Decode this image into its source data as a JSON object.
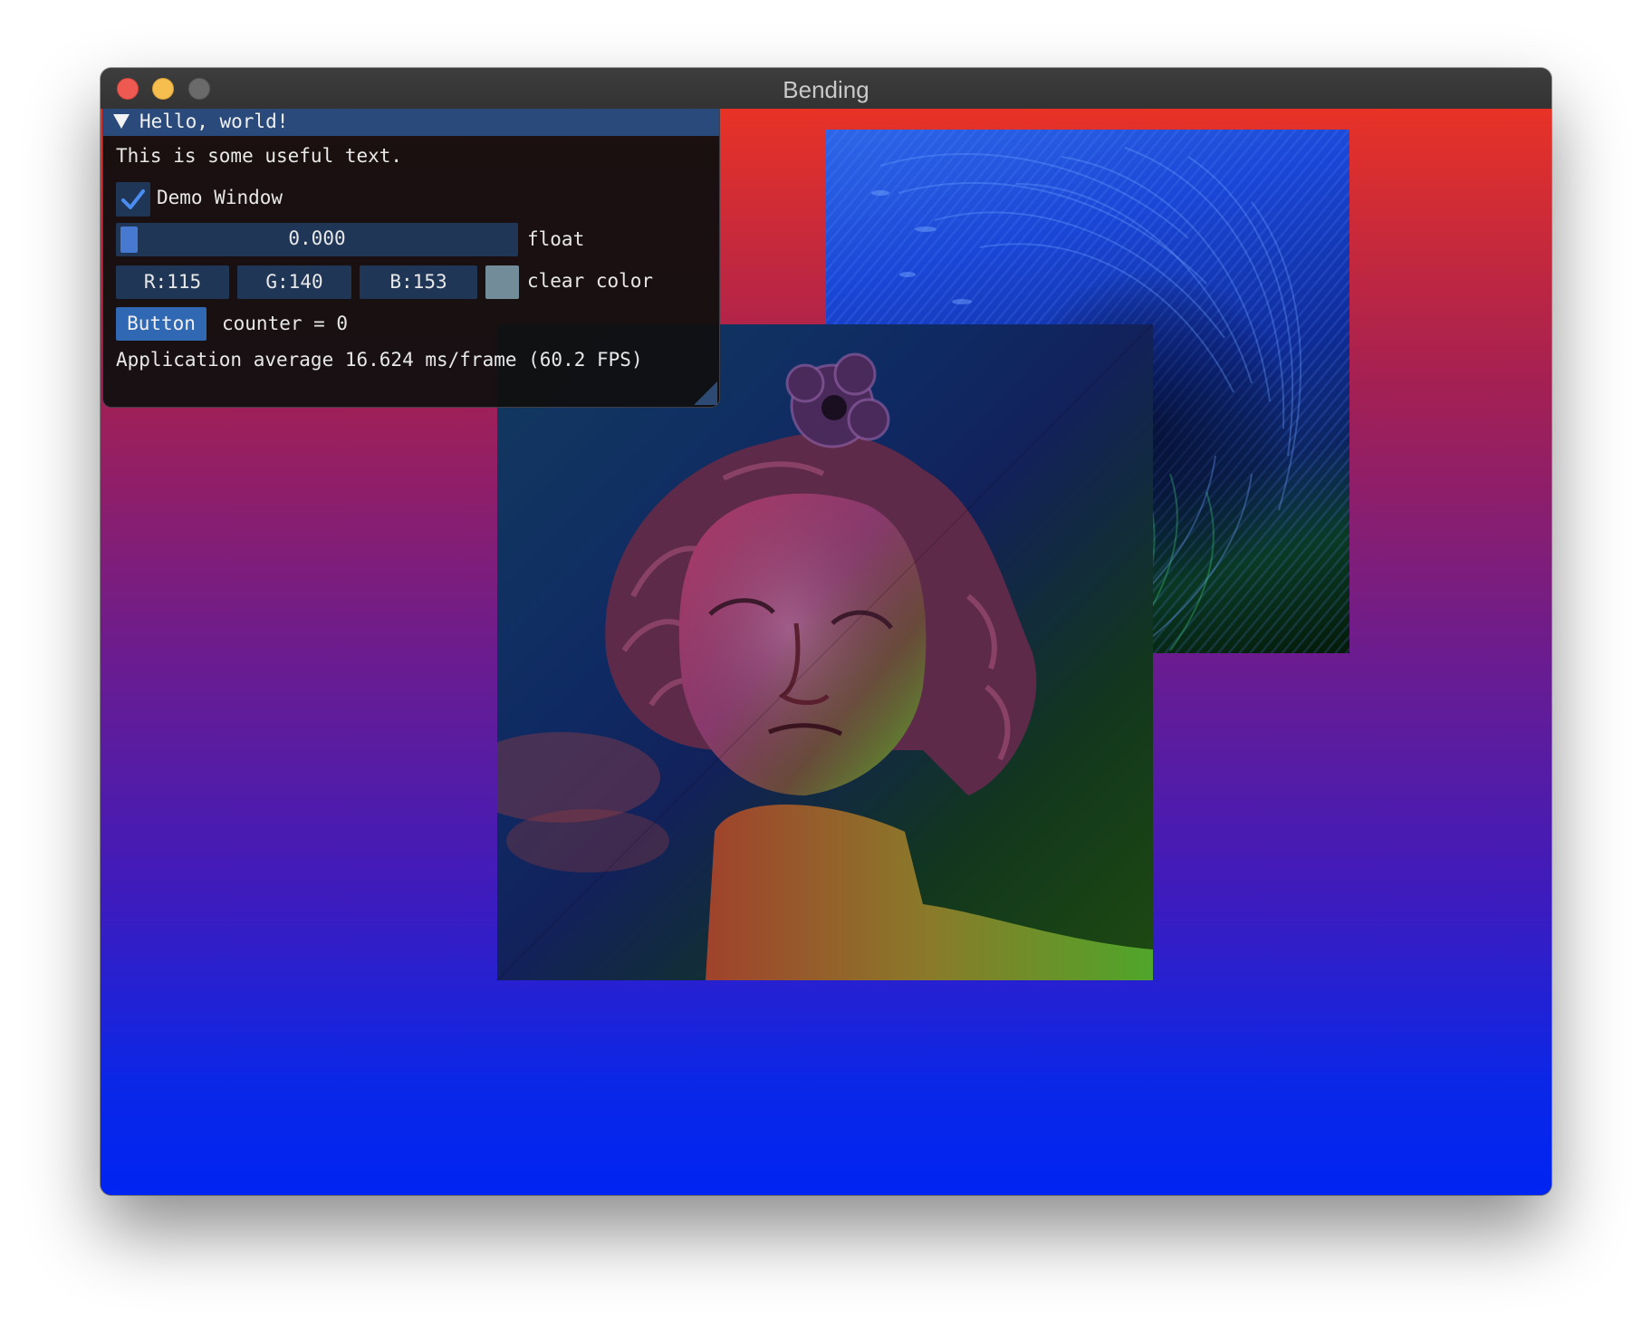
{
  "window": {
    "title": "Bending"
  },
  "imgui": {
    "title": "Hello, world!",
    "text": "This is some useful text.",
    "checkbox": {
      "label": "Demo Window",
      "checked": true
    },
    "slider": {
      "value_text": "0.000",
      "label": "float",
      "fraction": 0.0
    },
    "color": {
      "r": "R:115",
      "g": "G:140",
      "b": "B:153",
      "label": "clear color",
      "swatch": "#738c99"
    },
    "button": {
      "label": "Button"
    },
    "counter_text": "counter = 0",
    "fps_text": "Application average 16.624 ms/frame (60.2 FPS)"
  },
  "icons": {
    "collapse": "triangle-down-icon",
    "check": "checkmark-icon"
  },
  "colors": {
    "imgui_title": "#294a7a",
    "frame_bg": "#1f3657",
    "slider_grab": "#4679cf",
    "button": "#3068b3",
    "canvas_top": "#e83226",
    "canvas_bottom": "#0024f2"
  }
}
